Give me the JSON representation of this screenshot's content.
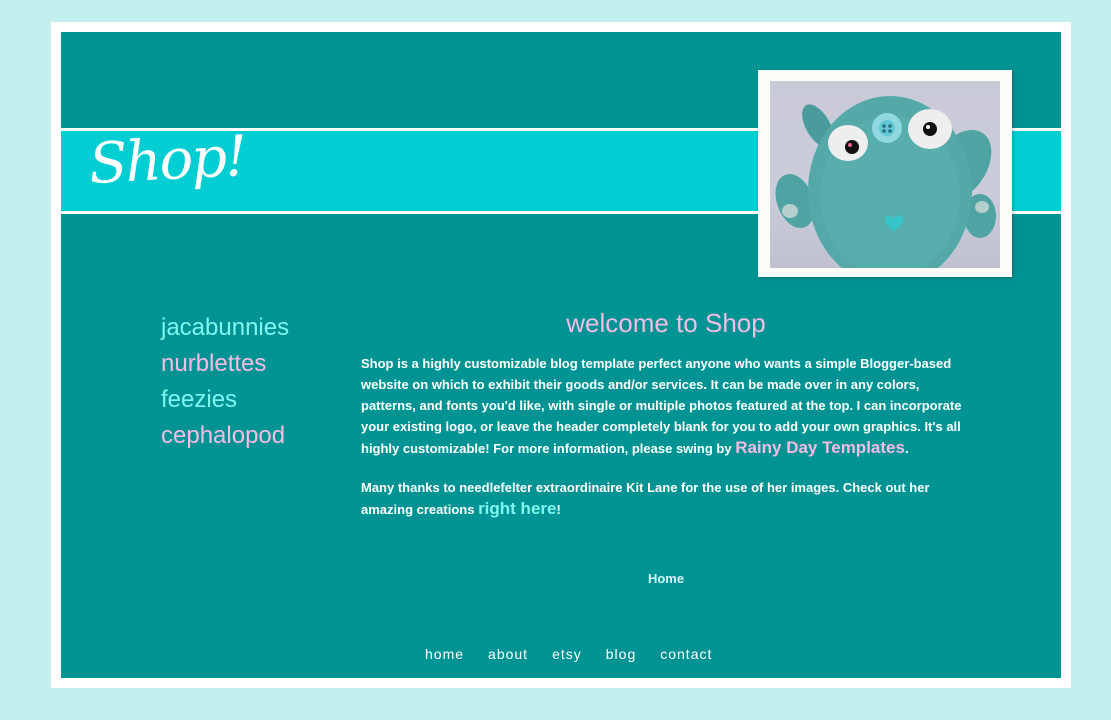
{
  "header": {
    "logo_text": "Shop!"
  },
  "sidebar": {
    "items": [
      {
        "label": "jacabunnies"
      },
      {
        "label": "nurblettes"
      },
      {
        "label": "feezies"
      },
      {
        "label": "cephalopod"
      }
    ]
  },
  "post": {
    "title": "welcome to Shop",
    "para1_text": "Shop is a highly customizable blog template perfect anyone who wants a simple Blogger-based website on which to exhibit their goods and/or services. It can be made over in any colors, patterns, and fonts you'd like, with single or multiple photos featured at the top. I can incorporate your existing logo, or leave the header completely blank for you to add your own graphics. It's all highly customizable! For more information, please swing by",
    "para1_link": "Rainy Day Templates",
    "para1_end": ".",
    "para2_text": "Many thanks to needlefelter extraordinaire Kit Lane for the use of her images. Check out her amazing creations",
    "para2_link": "right here",
    "para2_end": "!"
  },
  "home_link": "Home",
  "footer_nav": {
    "items": [
      {
        "label": "home"
      },
      {
        "label": "about"
      },
      {
        "label": "etsy"
      },
      {
        "label": "blog"
      },
      {
        "label": "contact"
      }
    ]
  },
  "colors": {
    "page_bg": "#c3f0ef",
    "main_bg": "#009393",
    "band": "#00ced3",
    "accent_pink": "#f4bde6",
    "accent_cyan": "#7ff7ef"
  }
}
